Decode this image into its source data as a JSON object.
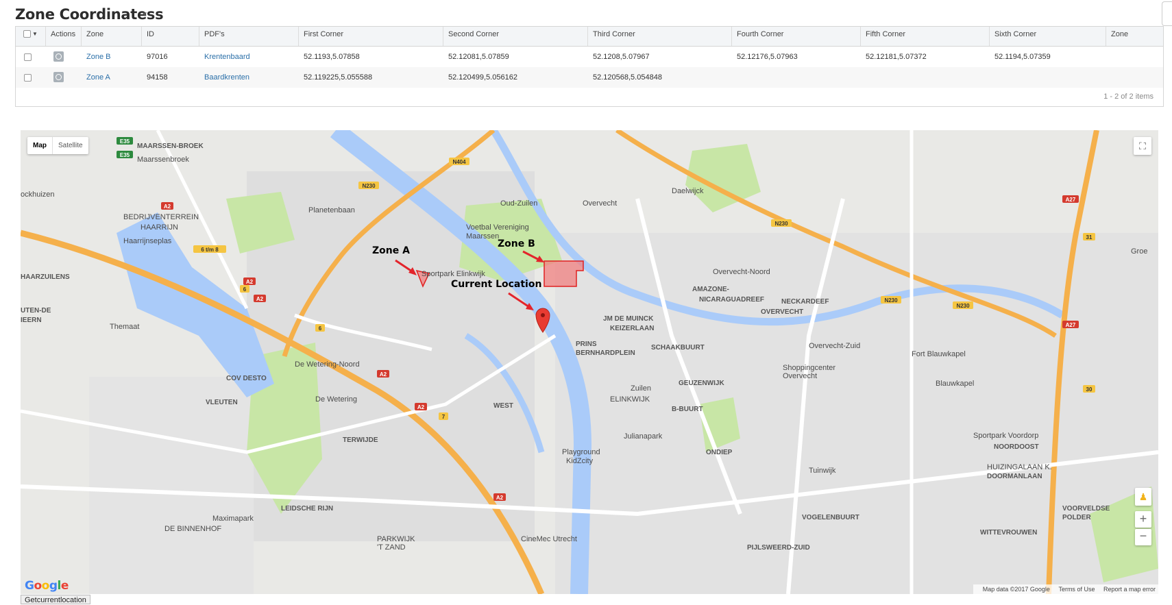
{
  "header": {
    "title": "Zone Coordinatess"
  },
  "grid": {
    "columns": [
      "Actions",
      "Zone",
      "ID",
      "PDF's",
      "First Corner",
      "Second Corner",
      "Third Corner",
      "Fourth Corner",
      "Fifth Corner",
      "Sixth Corner",
      "Zone"
    ],
    "rows": [
      {
        "zone": "Zone B",
        "id": "97016",
        "pdf": "Krentenbaard",
        "c1": "52.1193,5.07858",
        "c2": "52.12081,5.07859",
        "c3": "52.1208,5.07967",
        "c4": "52.12176,5.07963",
        "c5": "52.12181,5.07372",
        "c6": "52.1194,5.07359"
      },
      {
        "zone": "Zone A",
        "id": "94158",
        "pdf": "Baardkrenten",
        "c1": "52.119225,5.055588",
        "c2": "52.120499,5.056162",
        "c3": "52.120568,5.054848",
        "c4": "",
        "c5": "",
        "c6": ""
      }
    ],
    "pager": "1 - 2 of 2 items"
  },
  "map": {
    "type_options": [
      "Map",
      "Satellite"
    ],
    "annotations": {
      "zone_a": "Zone A",
      "zone_b": "Zone B",
      "current": "Current Location"
    },
    "colors": {
      "zone_fill": "#f08080",
      "zone_stroke": "#e02020",
      "arrow": "#e3242b",
      "water": "#aacbf9",
      "park": "#c8e6a6",
      "highway": "#f5b04b"
    },
    "labels": [
      "MAARSSEN-BROEK",
      "Maarssenbroek",
      "ockhuizen",
      "BEDRIJVENTERREIN",
      "HAARRIJN",
      "Haarrijnseplas",
      "HAARZUILENS",
      "UTEN-DE",
      "IEERN",
      "Themaat",
      "COV DESTO",
      "VLEUTEN",
      "TERWIJDE",
      "De Wetering",
      "De Wetering-Noord",
      "Planetenbaan",
      "Voetbal Vereniging",
      "Maarssen",
      "Sportpark Elinkwijk",
      "Oud-Zuilen",
      "Overvecht",
      "Daelwijck",
      "Overvecht-Noord",
      "NECKARDEEF",
      "OVERVECHT",
      "AMAZONE-",
      "NICARAGUADREEF",
      "JM DE MUINCK",
      "KEIZERLAAN",
      "PRINS",
      "BERNHARDPLEIN",
      "SCHAAKBUURT",
      "GEUZENWIJK",
      "Zuilen",
      "ELINKWIJK",
      "B-BUURT",
      "WEST",
      "Julianapark",
      "Playground",
      "KidZcity",
      "ONDIEP",
      "Tuinwijk",
      "Shoppingcenter",
      "Overvecht",
      "Overvecht-Zuid",
      "Fort Blauwkapel",
      "Blauwkapel",
      "NOORDOOST",
      "Sportpark Voordorp",
      "HUIZINGALAAN K.",
      "DOORMANLAAN",
      "VOGELENBUURT",
      "VOORVELDSE",
      "POLDER",
      "WITTEVROUWEN",
      "PIJLSWEERD-ZUID",
      "CineMec Utrecht",
      "LEIDSCHE RIJN",
      "Maximapark",
      "DE BINNENHOF",
      "PARKWIJK",
      "'T ZAND",
      "Groe"
    ],
    "road_shields": [
      "E35",
      "E35",
      "N230",
      "N404",
      "A2",
      "A2",
      "A2",
      "A2",
      "A2",
      "A2",
      "A27",
      "A27",
      "N230",
      "N230",
      "N230",
      "6",
      "6",
      "7",
      "31",
      "30",
      "6 t/m 8"
    ],
    "attribution": [
      "Map data ©2017 Google",
      "Terms of Use",
      "Report a map error"
    ],
    "google_logo": "Google"
  },
  "footer": {
    "button": "Getcurrentlocation"
  }
}
